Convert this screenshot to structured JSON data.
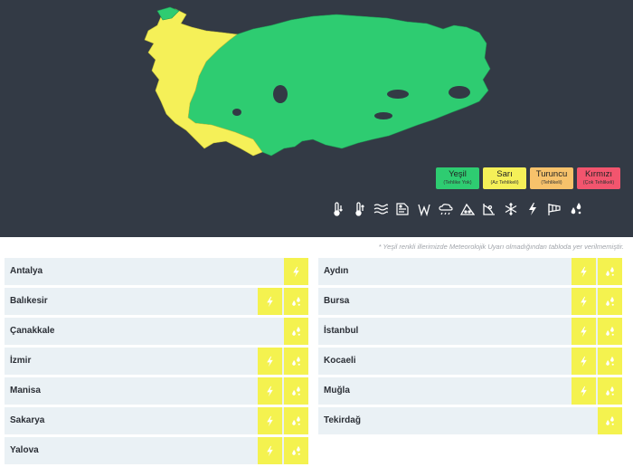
{
  "legend": [
    {
      "name": "Yeşil",
      "sub": "(Tehlike Yok)",
      "color": "#2ecc71"
    },
    {
      "name": "Sarı",
      "sub": "(Az Tehlikeli)",
      "color": "#f5f058"
    },
    {
      "name": "Turuncu",
      "sub": "(Tehlikeli)",
      "color": "#f7c26b"
    },
    {
      "name": "Kırmızı",
      "sub": "(Çok Tehlikeli)",
      "color": "#f2556e"
    }
  ],
  "hazards": [
    "cold-icon",
    "heat-icon",
    "fog-icon",
    "dust-icon",
    "wind-icon",
    "rain-snow-icon",
    "avalanche-icon",
    "landslide-icon",
    "snow-icon",
    "thunderstorm-icon",
    "windsock-icon",
    "heavy-rain-icon"
  ],
  "footnote": "* Yeşil renkli illerimizde Meteorolojik Uyarı olmadığından tabloda yer verilmemiştir.",
  "left_rows": [
    {
      "name": "Antalya",
      "warnings": [
        "thunderstorm"
      ]
    },
    {
      "name": "Balıkesir",
      "warnings": [
        "thunderstorm",
        "heavy-rain"
      ]
    },
    {
      "name": "Çanakkale",
      "warnings": [
        "heavy-rain"
      ]
    },
    {
      "name": "İzmir",
      "warnings": [
        "thunderstorm",
        "heavy-rain"
      ]
    },
    {
      "name": "Manisa",
      "warnings": [
        "thunderstorm",
        "heavy-rain"
      ]
    },
    {
      "name": "Sakarya",
      "warnings": [
        "thunderstorm",
        "heavy-rain"
      ]
    },
    {
      "name": "Yalova",
      "warnings": [
        "thunderstorm",
        "heavy-rain"
      ]
    }
  ],
  "right_rows": [
    {
      "name": "Aydın",
      "warnings": [
        "thunderstorm",
        "heavy-rain"
      ]
    },
    {
      "name": "Bursa",
      "warnings": [
        "thunderstorm",
        "heavy-rain"
      ]
    },
    {
      "name": "İstanbul",
      "warnings": [
        "thunderstorm",
        "heavy-rain"
      ]
    },
    {
      "name": "Kocaeli",
      "warnings": [
        "thunderstorm",
        "heavy-rain"
      ]
    },
    {
      "name": "Muğla",
      "warnings": [
        "thunderstorm",
        "heavy-rain"
      ]
    },
    {
      "name": "Tekirdağ",
      "warnings": [
        "heavy-rain"
      ]
    }
  ],
  "colors": {
    "panel": "#333a45",
    "green": "#2ecc71",
    "yellow": "#f5f058",
    "row": "#eaf1f5"
  }
}
